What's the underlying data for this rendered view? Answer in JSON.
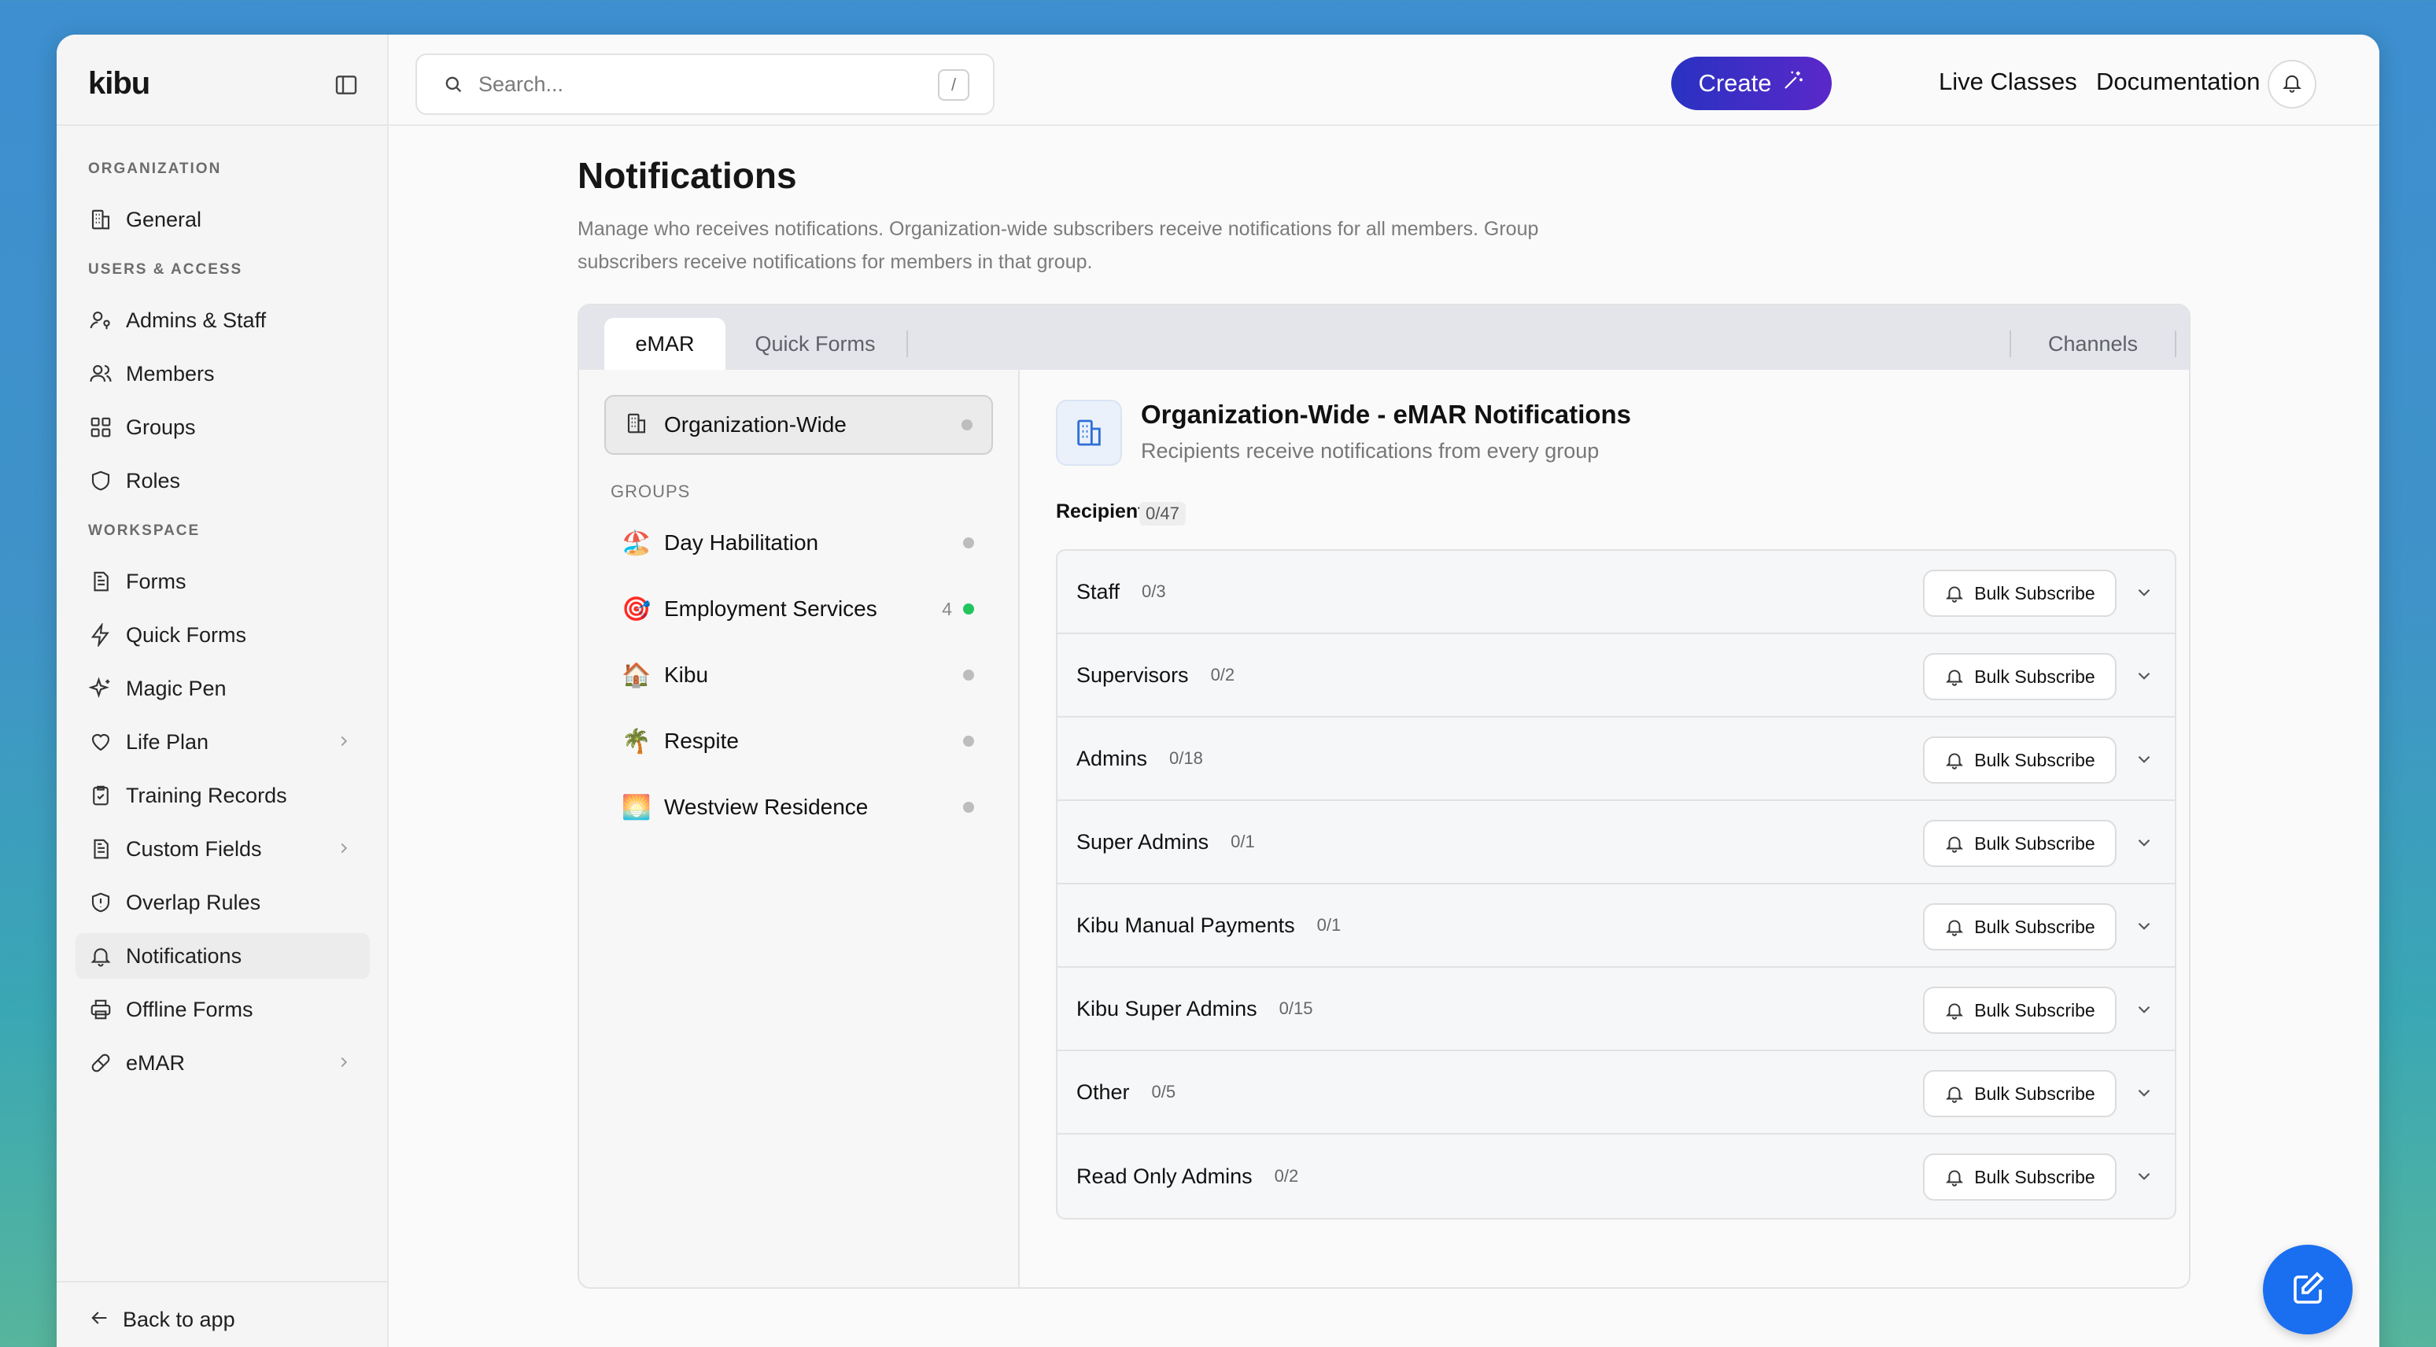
{
  "app": {
    "brand": "kibu"
  },
  "search": {
    "placeholder": "Search...",
    "shortcut": "/"
  },
  "topbar": {
    "create_label": "Create",
    "live_classes_label": "Live Classes",
    "documentation_label": "Documentation"
  },
  "sidebar": {
    "sections": {
      "organization": "ORGANIZATION",
      "users_access": "USERS & ACCESS",
      "workspace": "WORKSPACE"
    },
    "items": [
      {
        "label": "General",
        "icon": "building-icon"
      },
      {
        "label": "Admins & Staff",
        "icon": "user-key-icon"
      },
      {
        "label": "Members",
        "icon": "users-icon"
      },
      {
        "label": "Groups",
        "icon": "grid-icon"
      },
      {
        "label": "Roles",
        "icon": "shield-icon"
      },
      {
        "label": "Forms",
        "icon": "document-icon"
      },
      {
        "label": "Quick Forms",
        "icon": "lightning-icon"
      },
      {
        "label": "Magic Pen",
        "icon": "sparkles-icon"
      },
      {
        "label": "Life Plan",
        "icon": "heart-icon"
      },
      {
        "label": "Training Records",
        "icon": "clipboard-check-icon"
      },
      {
        "label": "Custom Fields",
        "icon": "document-icon"
      },
      {
        "label": "Overlap Rules",
        "icon": "shield-alert-icon"
      },
      {
        "label": "Notifications",
        "icon": "bell-icon"
      },
      {
        "label": "Offline Forms",
        "icon": "printer-icon"
      },
      {
        "label": "eMAR",
        "icon": "pill-icon"
      }
    ],
    "back_label": "Back to app"
  },
  "page": {
    "title": "Notifications",
    "description": "Manage who receives notifications. Organization-wide subscribers receive notifications for all members. Group subscribers receive notifications for members in that group."
  },
  "tabs": {
    "emar": "eMAR",
    "quick_forms": "Quick Forms",
    "channels": "Channels"
  },
  "groups_pane": {
    "org_wide_label": "Organization-Wide",
    "groups_heading": "GROUPS",
    "groups": [
      {
        "emoji": "🏖️",
        "label": "Day Habilitation",
        "count": "",
        "status_color": "#bdbdbd"
      },
      {
        "emoji": "🎯",
        "label": "Employment Services",
        "count": "4",
        "status_color": "#22c55e"
      },
      {
        "emoji": "🏠",
        "label": "Kibu",
        "count": "",
        "status_color": "#bdbdbd"
      },
      {
        "emoji": "🌴",
        "label": "Respite",
        "count": "",
        "status_color": "#bdbdbd"
      },
      {
        "emoji": "🌅",
        "label": "Westview Residence",
        "count": "",
        "status_color": "#bdbdbd"
      }
    ]
  },
  "detail": {
    "title": "Organization-Wide - eMAR Notifications",
    "subtitle": "Recipients receive notifications from every group",
    "recipients_label": "Recipients",
    "recipients_count": "0/47",
    "bulk_label": "Bulk Subscribe",
    "roles": [
      {
        "name": "Staff",
        "count": "0/3"
      },
      {
        "name": "Supervisors",
        "count": "0/2"
      },
      {
        "name": "Admins",
        "count": "0/18"
      },
      {
        "name": "Super Admins",
        "count": "0/1"
      },
      {
        "name": "Kibu Manual Payments",
        "count": "0/1"
      },
      {
        "name": "Kibu Super Admins",
        "count": "0/15"
      },
      {
        "name": "Other",
        "count": "0/5"
      },
      {
        "name": "Read Only Admins",
        "count": "0/2"
      }
    ]
  },
  "colors": {
    "accent": "#2932c2",
    "fab": "#1a6ef0",
    "online": "#22c55e"
  }
}
